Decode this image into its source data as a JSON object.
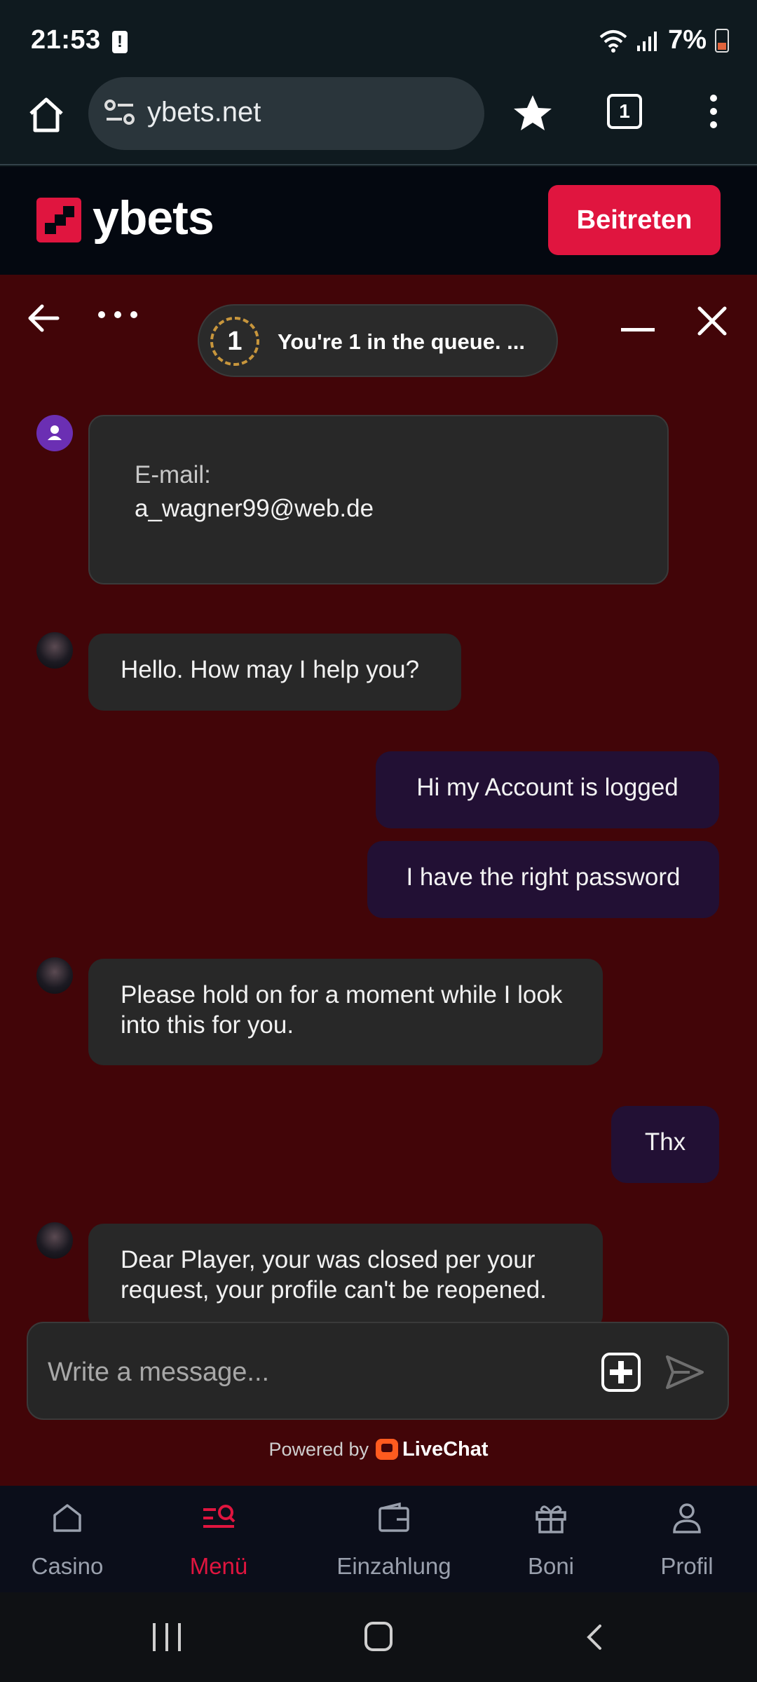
{
  "status_bar": {
    "time": "21:53",
    "battery_pct": "7%"
  },
  "browser": {
    "url": "ybets.net",
    "tab_count": "1"
  },
  "site": {
    "brand": "ybets",
    "join_label": "Beitreten"
  },
  "chat": {
    "queue_position": "1",
    "queue_text": "You're 1 in the queue. ...",
    "email_label": "E-mail:",
    "email_value": "a_wagner99@web.de",
    "messages": [
      {
        "from": "agent",
        "text": "Hello. How may I help you?"
      },
      {
        "from": "user",
        "text": "Hi my Account is logged"
      },
      {
        "from": "user",
        "text": "I have the right password"
      },
      {
        "from": "agent",
        "text": "Please hold on for a moment while I look into this for you."
      },
      {
        "from": "user",
        "text": "Thx"
      },
      {
        "from": "agent",
        "text": "Dear Player, your was closed per your request, your profile can't be reopened."
      }
    ],
    "input_placeholder": "Write a message...",
    "powered_by": "Powered by",
    "powered_brand": "LiveChat"
  },
  "bottom_nav": {
    "items": [
      {
        "label": "Casino",
        "icon": "home-icon",
        "active": false
      },
      {
        "label": "Menü",
        "icon": "menu-search-icon",
        "active": true
      },
      {
        "label": "Einzahlung",
        "icon": "wallet-icon",
        "active": false
      },
      {
        "label": "Boni",
        "icon": "gift-icon",
        "active": false
      },
      {
        "label": "Profil",
        "icon": "user-icon",
        "active": false
      }
    ]
  },
  "colors": {
    "brand_red": "#e0153f",
    "chat_background": "#420508",
    "agent_bubble": "#282828",
    "user_bubble": "#221034"
  }
}
